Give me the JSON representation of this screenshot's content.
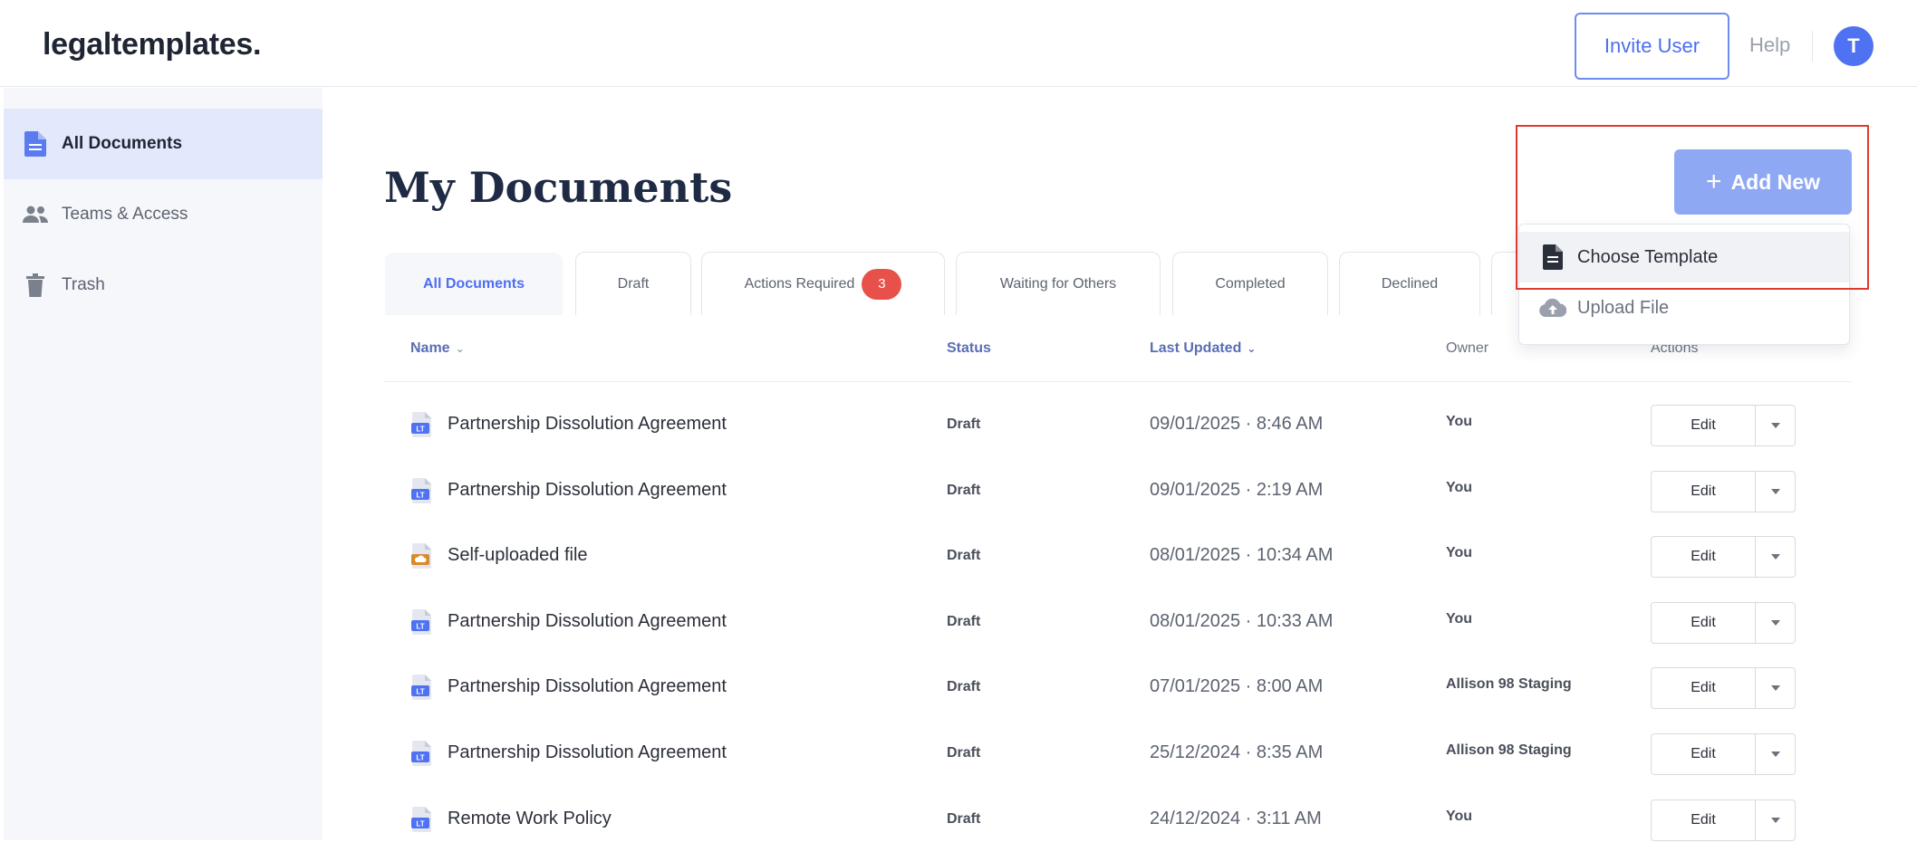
{
  "header": {
    "logo": "legaltemplates.",
    "invite_label": "Invite User",
    "help_label": "Help",
    "avatar_initial": "T",
    "accent_color": "#4f72f2"
  },
  "sidebar": {
    "items": [
      {
        "label": "All Documents",
        "icon": "document-icon",
        "active": true
      },
      {
        "label": "Teams & Access",
        "icon": "people-icon",
        "active": false
      },
      {
        "label": "Trash",
        "icon": "trash-icon",
        "active": false
      }
    ]
  },
  "main": {
    "title": "My Documents",
    "add_new_label": "Add New",
    "add_menu": [
      {
        "label": "Choose Template",
        "icon": "document-icon"
      },
      {
        "label": "Upload File",
        "icon": "cloud-upload-icon"
      }
    ],
    "tabs": [
      {
        "label": "All Documents",
        "active": true
      },
      {
        "label": "Draft"
      },
      {
        "label": "Actions Required",
        "badge": "3"
      },
      {
        "label": "Waiting for Others"
      },
      {
        "label": "Completed"
      },
      {
        "label": "Declined"
      }
    ],
    "table": {
      "columns": [
        "Name",
        "Status",
        "Last Updated",
        "Owner",
        "Actions"
      ],
      "edit_label": "Edit",
      "rows": [
        {
          "name": "Partnership Dissolution Agreement",
          "icon": "legal-template-icon",
          "status": "Draft",
          "updated": "09/01/2025 · 8:46 AM",
          "owner": "You"
        },
        {
          "name": "Partnership Dissolution Agreement",
          "icon": "legal-template-icon",
          "status": "Draft",
          "updated": "09/01/2025 · 2:19 AM",
          "owner": "You"
        },
        {
          "name": "Self-uploaded file",
          "icon": "uploaded-file-icon",
          "status": "Draft",
          "updated": "08/01/2025 · 10:34 AM",
          "owner": "You"
        },
        {
          "name": "Partnership Dissolution Agreement",
          "icon": "legal-template-icon",
          "status": "Draft",
          "updated": "08/01/2025 · 10:33 AM",
          "owner": "You"
        },
        {
          "name": "Partnership Dissolution Agreement",
          "icon": "legal-template-icon",
          "status": "Draft",
          "updated": "07/01/2025 · 8:00 AM",
          "owner": "Allison 98 Staging"
        },
        {
          "name": "Partnership Dissolution Agreement",
          "icon": "legal-template-icon",
          "status": "Draft",
          "updated": "25/12/2024 · 8:35 AM",
          "owner": "Allison 98 Staging"
        },
        {
          "name": "Remote Work Policy",
          "icon": "legal-template-icon",
          "status": "Draft",
          "updated": "24/12/2024 · 3:11 AM",
          "owner": "You"
        }
      ]
    }
  }
}
